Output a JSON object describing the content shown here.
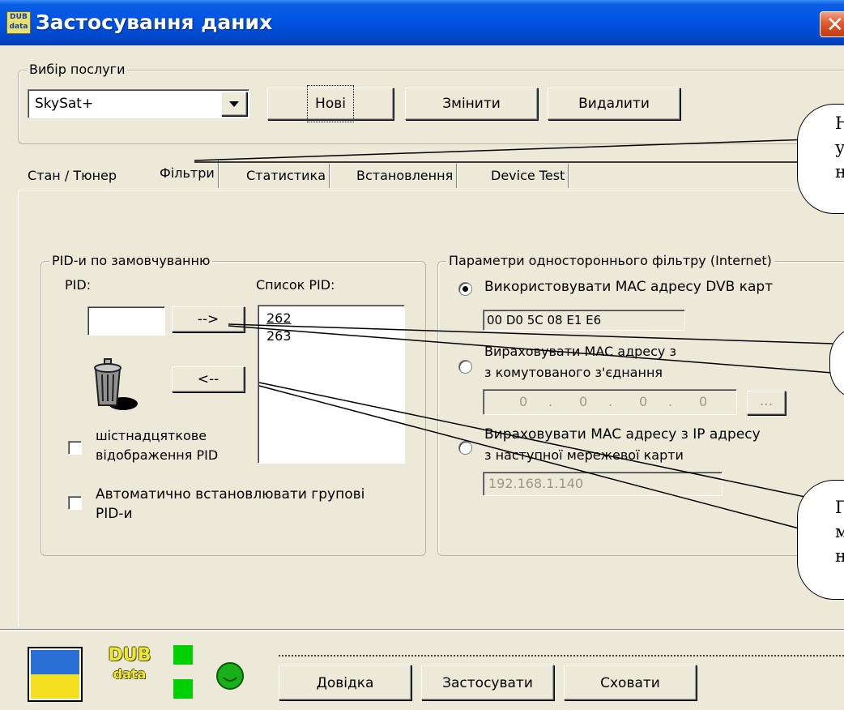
{
  "window": {
    "icon_text": "DUB data",
    "title": "Застосування даних",
    "close_glyph": "✕"
  },
  "service_group": {
    "legend": "Вибір послуги",
    "selected_service": "SkySat+",
    "dropdown_icon": "chevron-down-icon",
    "buttons": {
      "new": "Нові",
      "change": "Змінити",
      "delete": "Видалити"
    }
  },
  "tabs": [
    "Стан / Тюнер",
    "Фільтри",
    "Статистика",
    "Встановлення",
    "Device Test"
  ],
  "active_tab": "Фільтри",
  "pid_group": {
    "legend": "PID-и по замовчуванню",
    "pid_label": "PID:",
    "pid_value": "",
    "list_label": "Список PID:",
    "add_button": "-->",
    "remove_button": "<--",
    "pid_list": [
      "262",
      "263"
    ],
    "hex_checkbox": {
      "label_line1": "шістнадцяткове",
      "label_line2": "відображення PID",
      "checked": false
    },
    "auto_checkbox": {
      "label_line1": "Автоматично встановлювати групові",
      "label_line2": "PID-и",
      "checked": false
    }
  },
  "filter_group": {
    "legend": "Параметри одностороннього фільтру (Internet)",
    "option1": {
      "label": "Використовувати MAC адресу DVB карт",
      "value": "00 D0 5C 08 E1 E6",
      "selected": true
    },
    "option2": {
      "label_line1": "Вираховувати MAC адресу з",
      "label_line2": "з комутованого з'єднання",
      "ip": [
        "0",
        "0",
        "0",
        "0"
      ],
      "browse": "...",
      "selected": false
    },
    "option3": {
      "label_line1": "Вираховувати MAC адресу з IP адресу",
      "label_line2": "з наступної мережевої карти",
      "value": "192.168.1.140",
      "selected": false
    }
  },
  "callouts": [
    {
      "line1": "Н",
      "line2": "ус",
      "line3": "н"
    },
    {
      "line1": "",
      "line2": "",
      "line3": ""
    },
    {
      "line1": "П",
      "line2": "м",
      "line3": "н"
    }
  ],
  "footer": {
    "logo_text_top": "DUB",
    "logo_text_bottom": "data",
    "help": "Довідка",
    "apply": "Застосувати",
    "hide": "Сховати"
  },
  "colors": {
    "title_bar": "#0054e3",
    "window_bg": "#ece9d8",
    "led_green": "#00d000",
    "status_green": "#18b018",
    "flag_blue": "#2a6fd6",
    "flag_yellow": "#f4e020"
  }
}
